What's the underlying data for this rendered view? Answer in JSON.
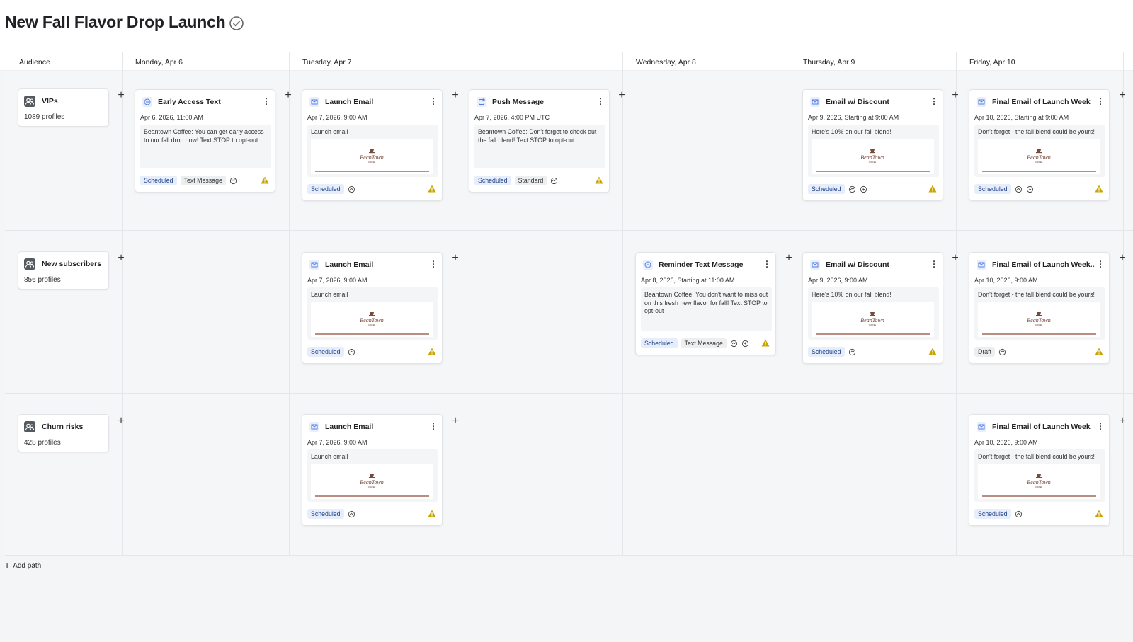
{
  "page": {
    "title": "New Fall Flavor Drop Launch"
  },
  "columns": {
    "audience": "Audience",
    "mon": "Monday, Apr 6",
    "tue": "Tuesday, Apr 7",
    "wed": "Wednesday, Apr 8",
    "thu": "Thursday, Apr 9",
    "fri": "Friday, Apr 10"
  },
  "audiences": [
    {
      "name": "VIPs",
      "count": "1089 profiles"
    },
    {
      "name": "New subscribers",
      "count": "856 profiles"
    },
    {
      "name": "Churn risks",
      "count": "428 profiles"
    }
  ],
  "cards": {
    "r1_mon": {
      "title": "Early Access Text",
      "date": "Apr 6, 2026, 11:00 AM",
      "body": "Beantown Coffee: You can get early access to our fall drop now! Text STOP to opt-out",
      "status": "Scheduled",
      "type": "Text Message"
    },
    "r1_tue_email": {
      "title": "Launch Email",
      "date": "Apr 7, 2026, 9:00 AM",
      "preview": "Launch email",
      "status": "Scheduled"
    },
    "r1_tue_push": {
      "title": "Push Message",
      "date": "Apr 7, 2026, 4:00 PM UTC",
      "body": "Beantown Coffee: Don't forget to check out the fall blend! Text STOP to opt-out",
      "status": "Scheduled",
      "type": "Standard"
    },
    "r1_thu": {
      "title": "Email w/ Discount",
      "date": "Apr 9, 2026, Starting at 9:00 AM",
      "preview": "Here's 10% on our fall blend!",
      "status": "Scheduled"
    },
    "r1_fri": {
      "title": "Final Email of Launch Week",
      "date": "Apr 10, 2026, Starting at 9:00 AM",
      "preview": "Don't forget - the fall blend could be yours!",
      "status": "Scheduled"
    },
    "r2_tue": {
      "title": "Launch Email",
      "date": "Apr 7, 2026, 9:00 AM",
      "preview": "Launch email",
      "status": "Scheduled"
    },
    "r2_wed": {
      "title": "Reminder Text Message",
      "date": "Apr 8, 2026, Starting at 11:00 AM",
      "body": "Beantown Coffee: You don't want to miss out on this fresh new flavor for fall! Text STOP to opt-out",
      "status": "Scheduled",
      "type": "Text Message"
    },
    "r2_thu": {
      "title": "Email w/ Discount",
      "date": "Apr 9, 2026, 9:00 AM",
      "preview": "Here's 10% on our fall blend!",
      "status": "Scheduled"
    },
    "r2_fri": {
      "title": "Final Email of Launch Week...",
      "date": "Apr 10, 2026, 9:00 AM",
      "preview": "Don't forget - the fall blend could be yours!",
      "status": "Draft"
    },
    "r3_tue": {
      "title": "Launch Email",
      "date": "Apr 7, 2026, 9:00 AM",
      "preview": "Launch email",
      "status": "Scheduled"
    },
    "r3_fri": {
      "title": "Final Email of Launch Week",
      "date": "Apr 10, 2026, 9:00 AM",
      "preview": "Don't forget - the fall blend could be yours!",
      "status": "Scheduled"
    }
  },
  "footer": {
    "add_path": "Add path"
  },
  "logo_text": {
    "brand": "BeanTown",
    "sub": "COFFEE"
  },
  "colors": {
    "scheduled_bg": "#e6eefc",
    "scheduled_text": "#1f3f85",
    "warning": "#c9a400",
    "email_icon": "#4f7ce0"
  },
  "icons": {
    "audience": "audience-group-icon",
    "email": "email-icon",
    "text": "text-message-icon",
    "push": "push-notification-icon",
    "warning": "warning-icon",
    "smart_send": "smart-send-icon",
    "lightning": "lightning-icon"
  }
}
